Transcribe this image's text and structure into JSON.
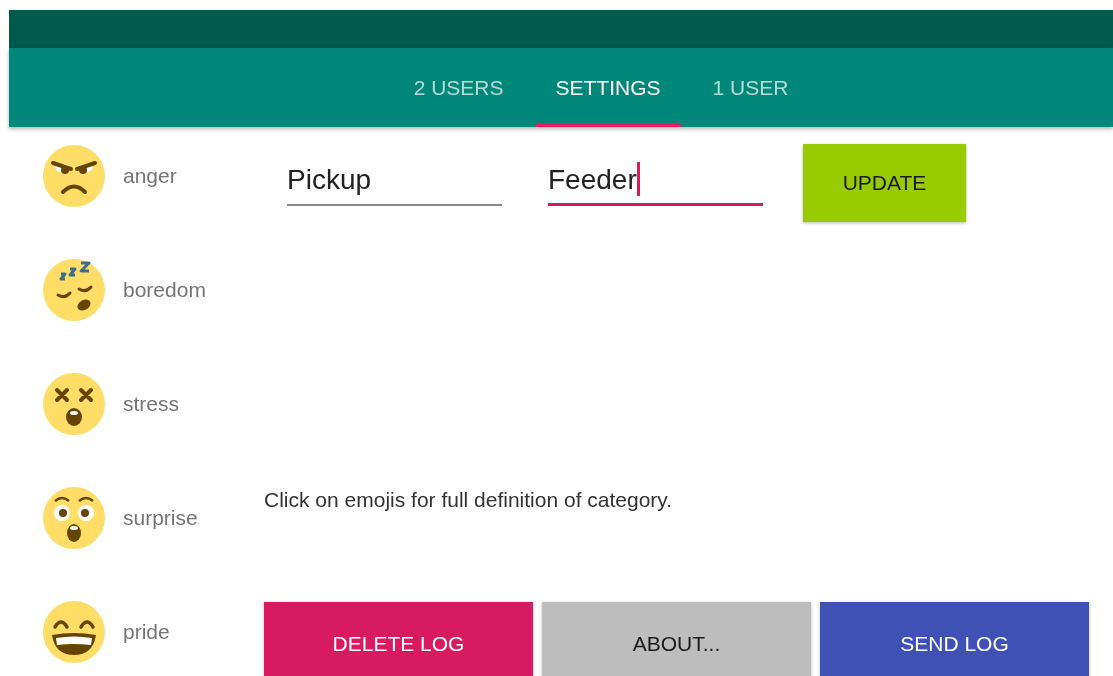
{
  "tabs": [
    {
      "label": "2 USERS",
      "selected": false
    },
    {
      "label": "SETTINGS",
      "selected": true
    },
    {
      "label": "1 USER",
      "selected": false
    }
  ],
  "emotions": [
    {
      "kind": "anger",
      "label": "anger"
    },
    {
      "kind": "boredom",
      "label": "boredom"
    },
    {
      "kind": "stress",
      "label": "stress"
    },
    {
      "kind": "surprise",
      "label": "surprise"
    },
    {
      "kind": "pride",
      "label": "pride"
    }
  ],
  "fields": [
    {
      "value": "Pickup",
      "focused": false
    },
    {
      "value": "Feeder",
      "focused": true
    }
  ],
  "update_button": {
    "label": "UPDATE",
    "color": "#99cc00"
  },
  "hint": "Click on emojis for full definition of category.",
  "buttons": [
    {
      "label": "DELETE LOG",
      "color": "#d81b60"
    },
    {
      "label": "ABOUT...",
      "color": "#bdbdbd"
    },
    {
      "label": "SEND LOG",
      "color": "#3f51b5"
    }
  ]
}
